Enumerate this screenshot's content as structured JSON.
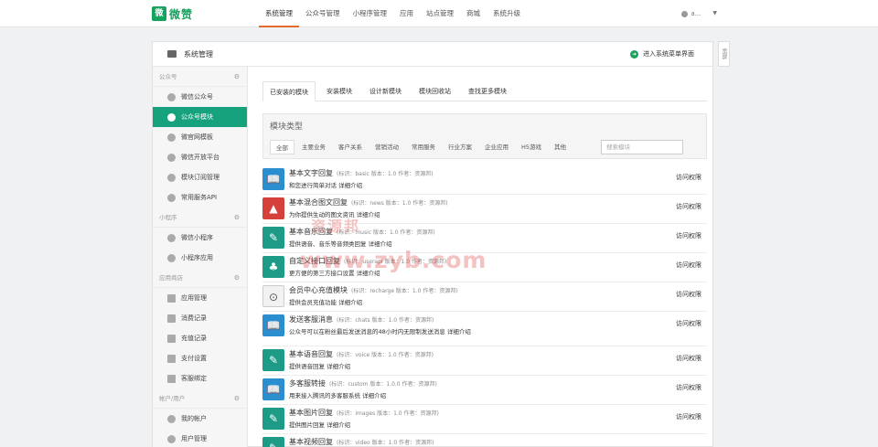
{
  "brand": {
    "logo_glyph": "微",
    "logo_text": "微赞"
  },
  "nav": [
    {
      "label": "系统管理",
      "active": true
    },
    {
      "label": "公众号管理"
    },
    {
      "label": "小程序管理"
    },
    {
      "label": "应用"
    },
    {
      "label": "站点管理"
    },
    {
      "label": "商城"
    },
    {
      "label": "系统升级"
    }
  ],
  "user": {
    "name": "a..."
  },
  "panel": {
    "title": "系统管理",
    "enter_simple": "进入系统菜单界面",
    "wide_toggle": "宽屏"
  },
  "sidebar": {
    "sections": [
      {
        "title": "公众号",
        "items": [
          {
            "label": "微信公众号"
          },
          {
            "label": "公众号模块",
            "active": true
          },
          {
            "label": "微官网模板"
          },
          {
            "label": "微信开放平台"
          },
          {
            "label": "模块订阅管理"
          },
          {
            "label": "常用服务API"
          }
        ]
      },
      {
        "title": "小程序",
        "items": [
          {
            "label": "微信小程序"
          },
          {
            "label": "小程序应用"
          }
        ]
      },
      {
        "title": "应用商店",
        "items": [
          {
            "label": "应用管理"
          },
          {
            "label": "消费记录"
          },
          {
            "label": "充值记录"
          },
          {
            "label": "支付设置"
          },
          {
            "label": "客服绑定"
          }
        ]
      },
      {
        "title": "帐户/用户",
        "items": [
          {
            "label": "我的帐户"
          },
          {
            "label": "用户管理"
          }
        ]
      }
    ]
  },
  "tabs": [
    {
      "label": "已安装的模块",
      "active": true
    },
    {
      "label": "安装模块"
    },
    {
      "label": "设计新模块"
    },
    {
      "label": "模块回收站"
    },
    {
      "label": "查找更多模块"
    }
  ],
  "filter": {
    "title": "模块类型",
    "categories": [
      {
        "label": "全部",
        "active": true
      },
      {
        "label": "主要业务"
      },
      {
        "label": "客户关系"
      },
      {
        "label": "营销活动"
      },
      {
        "label": "常用服务"
      },
      {
        "label": "行业方案"
      },
      {
        "label": "企业应用"
      },
      {
        "label": "H5游戏"
      },
      {
        "label": "其他"
      }
    ],
    "search_placeholder": "搜索模块"
  },
  "modules": [
    {
      "name": "基本文字回复",
      "meta": "(标识：basic  版本：1.0  作者：资源邦)",
      "desc": "和您进行简单对话 详细介绍",
      "access": "访问权限",
      "color": "#2b8ecf",
      "icon": "book-icon",
      "glyph": "📖"
    },
    {
      "name": "基本混合图文回复",
      "meta": "(标识：news  版本：1.0  作者：资源邦)",
      "desc": "为你提供生动的图文资讯 详细介绍",
      "access": "访问权限",
      "color": "#d6403b",
      "icon": "image-icon",
      "glyph": "▲"
    },
    {
      "name": "基本音乐回复",
      "meta": "(标识：music  版本：1.0  作者：资源邦)",
      "desc": "提供语音、音乐等音频类回复 详细介绍",
      "access": "访问权限",
      "color": "#1d9b87",
      "icon": "satellite-icon",
      "glyph": "✎"
    },
    {
      "name": "自定义接口回复",
      "meta": "(标识：userapi  版本：1.0  作者：资源邦)",
      "desc": "更方便的第三方接口设置 详细介绍",
      "access": "访问权限",
      "color": "#1d9b87",
      "icon": "network-icon",
      "glyph": "♣"
    },
    {
      "name": "会员中心充值模块",
      "meta": "(标识：recharge  版本：1.0  作者：资源邦)",
      "desc": "提供会员充值功能 详细介绍",
      "access": "访问权限",
      "color": "#f2f2f2",
      "icon": "vip-card-icon",
      "glyph": "⊙"
    },
    {
      "name": "发送客服消息",
      "meta": "(标识：chats  版本：1.0  作者：资源邦)",
      "desc": "公众号可以在粉丝最后发送消息的48小时内无限制发送消息 详细介绍",
      "access": "访问权限",
      "color": "#2b8ecf",
      "icon": "book-icon",
      "glyph": "📖"
    },
    {
      "name": "基本语音回复",
      "meta": "(标识：voice  版本：1.0  作者：资源邦)",
      "desc": "提供语音回复 详细介绍",
      "access": "访问权限",
      "color": "#1d9b87",
      "icon": "satellite-icon",
      "glyph": "✎"
    },
    {
      "name": "多客服转接",
      "meta": "(标识：custom  版本：1.0.0  作者：资源邦)",
      "desc": "用来接入腾讯的多客服系统 详细介绍",
      "access": "访问权限",
      "color": "#2b8ecf",
      "icon": "book-icon",
      "glyph": "📖"
    },
    {
      "name": "基本图片回复",
      "meta": "(标识：images  版本：1.0  作者：资源邦)",
      "desc": "提供图片回复 详细介绍",
      "access": "访问权限",
      "color": "#1d9b87",
      "icon": "satellite-icon",
      "glyph": "✎"
    },
    {
      "name": "基本视频回复",
      "meta": "(标识：video  版本：1.0  作者：资源邦)",
      "desc": "",
      "access": "",
      "color": "#1d9b87",
      "icon": "satellite-icon",
      "glyph": "✎"
    }
  ],
  "watermark": {
    "cn": "资源邦",
    "url": "www.zyb.com"
  }
}
